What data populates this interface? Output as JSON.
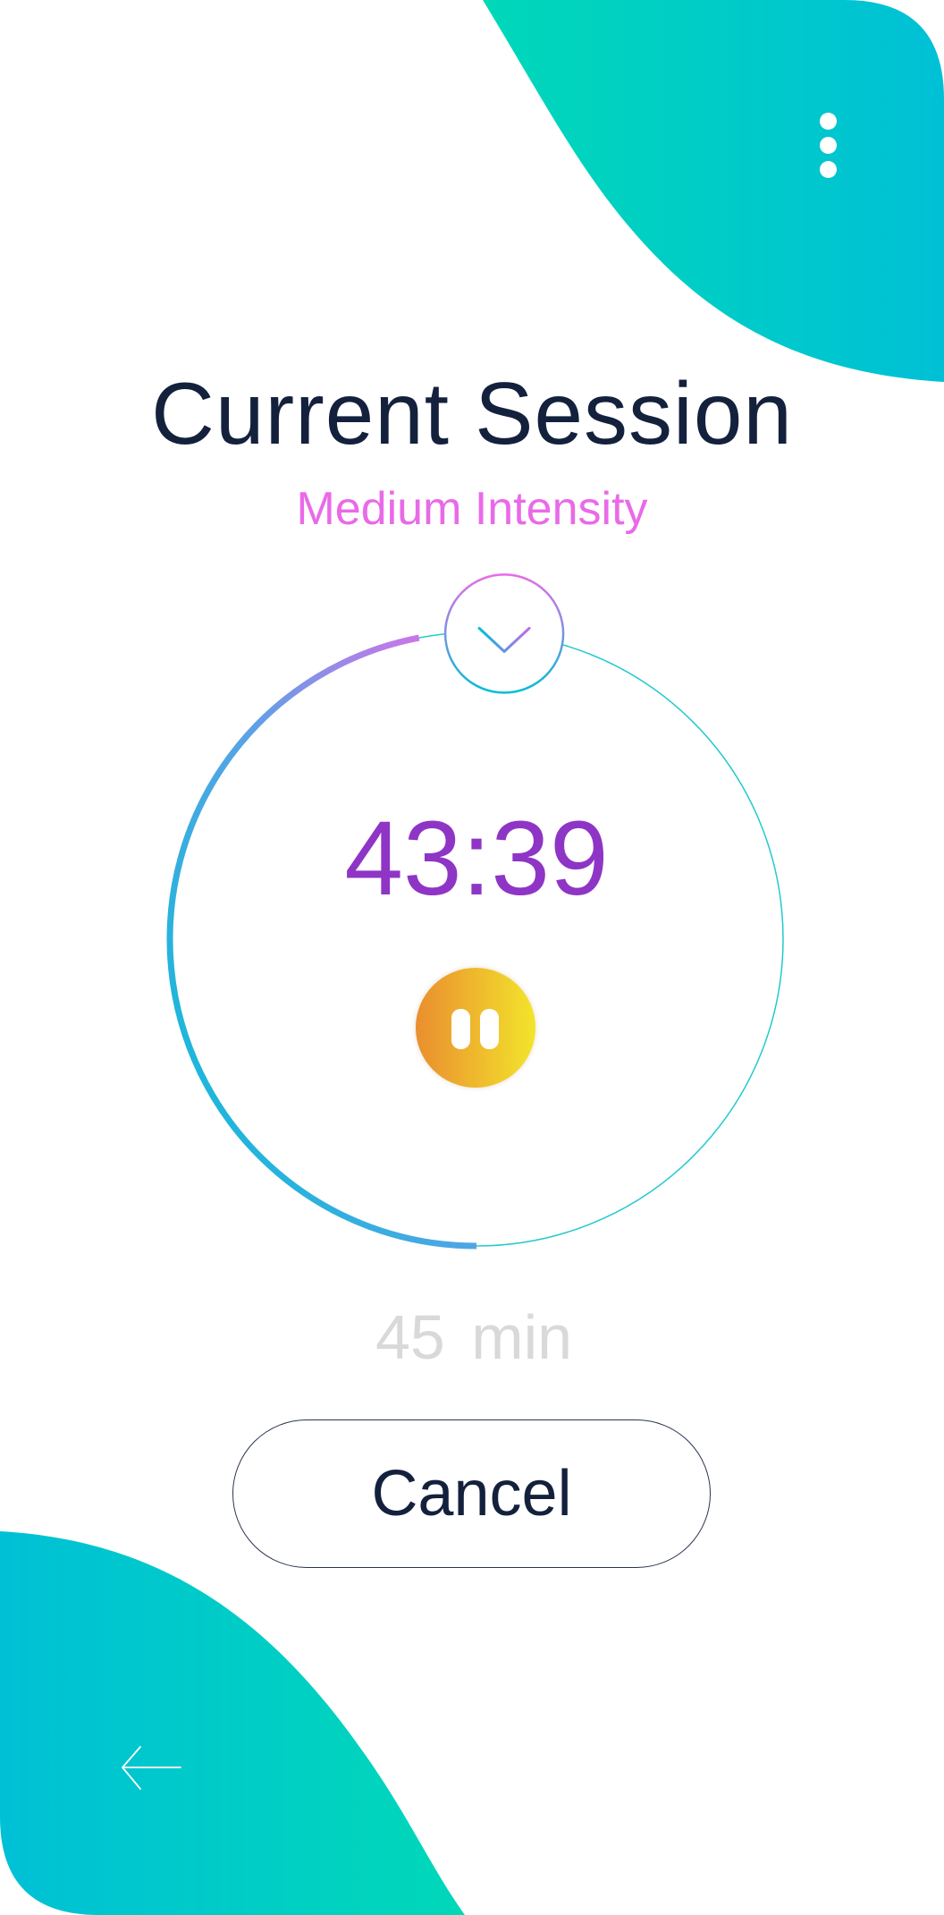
{
  "header": {
    "more_menu_icon": "more-vertical-icon"
  },
  "session": {
    "title": "Current Session",
    "intensity": "Medium Intensity",
    "remaining_time": "43:39",
    "duration_value": "45",
    "duration_unit": "min",
    "progress_fraction": 0.47
  },
  "controls": {
    "pause_icon": "pause-icon",
    "knob_icon": "chevron-down-icon",
    "cancel_label": "Cancel",
    "back_icon": "arrow-left-icon"
  },
  "colors": {
    "teal": "#00c0d6",
    "green": "#00d8b8",
    "accent_pink": "#e96ae8",
    "accent_purple": "#8e35c6",
    "navy": "#14213d",
    "orange": "#ea8e2f",
    "yellow": "#f3e42b"
  }
}
